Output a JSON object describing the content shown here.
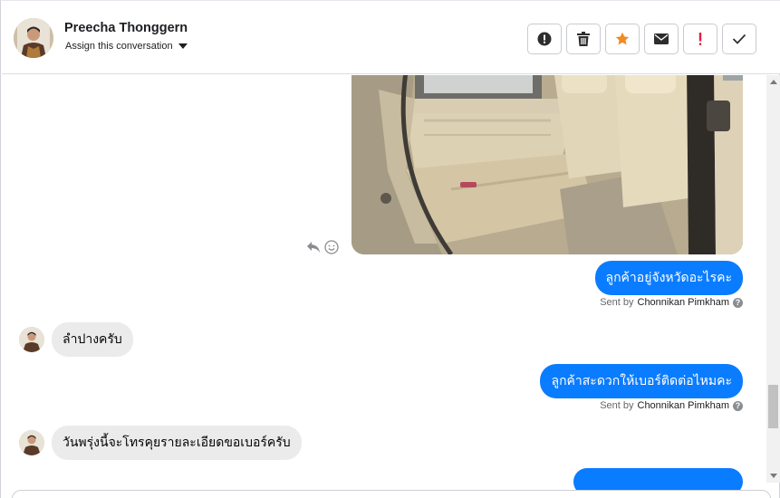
{
  "header": {
    "contact_name": "Preecha Thonggern",
    "assign_label": "Assign this conversation"
  },
  "toolbar": {
    "buttons": [
      {
        "icon": "alert-circle-icon"
      },
      {
        "icon": "trash-icon"
      },
      {
        "icon": "star-icon",
        "color": "#f08a24"
      },
      {
        "icon": "envelope-icon"
      },
      {
        "icon": "exclamation-icon",
        "color": "#e41e3f"
      },
      {
        "icon": "check-icon"
      }
    ]
  },
  "messages": [
    {
      "direction": "outgoing",
      "type": "image",
      "icon": "car-interior-photo"
    },
    {
      "direction": "outgoing",
      "text": "ลูกค้าอยู่จังหวัดอะไรคะ",
      "sent_by_prefix": "Sent by",
      "sent_by": "Chonnikan Pimkham"
    },
    {
      "direction": "incoming",
      "text": "ลำปางครับ"
    },
    {
      "direction": "outgoing",
      "text": "ลูกค้าสะดวกให้เบอร์ติดต่อไหมคะ",
      "sent_by_prefix": "Sent by",
      "sent_by": "Chonnikan Pimkham"
    },
    {
      "direction": "incoming",
      "text": "วันพรุ่งนี้จะโทรคุยรายละเอียดขอเบอร์ครับ"
    }
  ],
  "colors": {
    "outgoing_bubble": "#0a7cff",
    "incoming_bubble": "#ebebeb"
  }
}
